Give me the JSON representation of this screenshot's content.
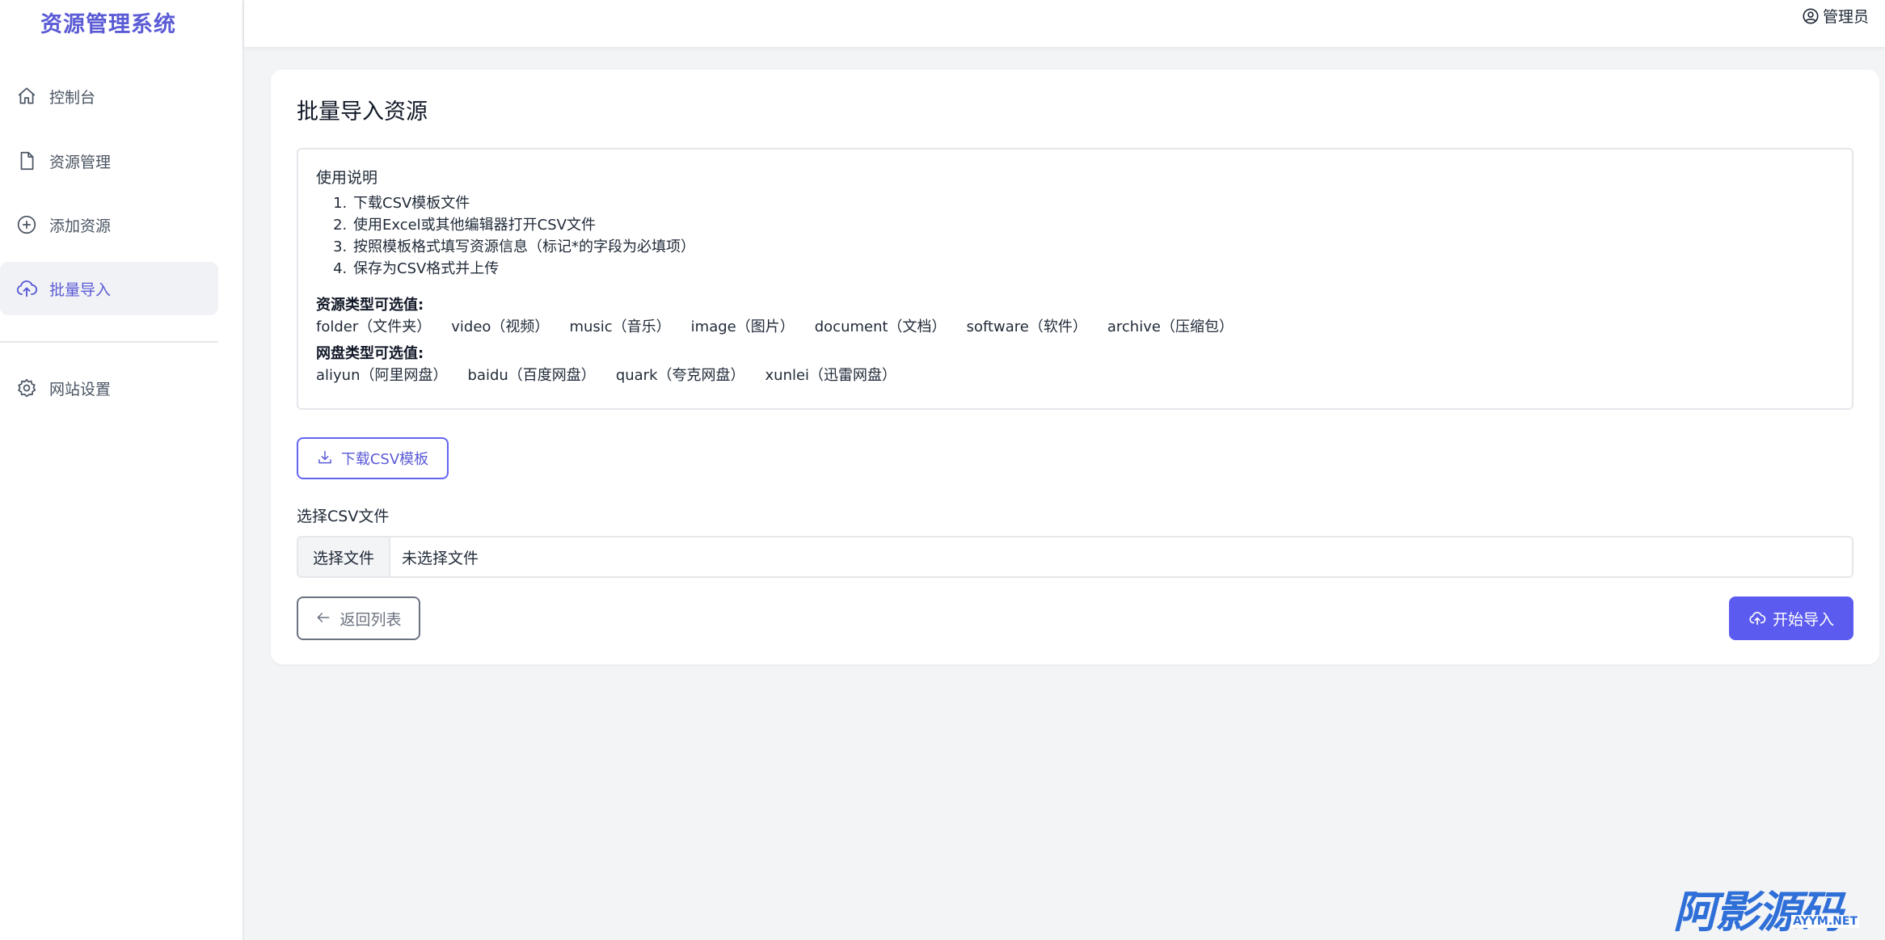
{
  "app": {
    "title": "资源管理系统"
  },
  "sidebar": {
    "items": [
      {
        "label": "控制台",
        "icon": "home-icon"
      },
      {
        "label": "资源管理",
        "icon": "file-icon"
      },
      {
        "label": "添加资源",
        "icon": "plus-circle-icon"
      },
      {
        "label": "批量导入",
        "icon": "cloud-upload-icon",
        "active": true
      },
      {
        "label": "网站设置",
        "icon": "gear-icon"
      }
    ]
  },
  "topbar": {
    "user": "管理员"
  },
  "page": {
    "title": "批量导入资源",
    "instructions": {
      "title": "使用说明",
      "steps": [
        "下载CSV模板文件",
        "使用Excel或其他编辑器打开CSV文件",
        "按照模板格式填写资源信息（标记*的字段为必填项）",
        "保存为CSV格式并上传"
      ],
      "type_title": "资源类型可选值:",
      "types": [
        "folder（文件夹）",
        "video（视频）",
        "music（音乐）",
        "image（图片）",
        "document（文档）",
        "software（软件）",
        "archive（压缩包）"
      ],
      "disk_title": "网盘类型可选值:",
      "disks": [
        "aliyun（阿里网盘）",
        "baidu（百度网盘）",
        "quark（夸克网盘）",
        "xunlei（迅雷网盘）"
      ]
    },
    "download_button": "下载CSV模板",
    "file_label": "选择CSV文件",
    "file_button": "选择文件",
    "file_status": "未选择文件",
    "back_button": "返回列表",
    "import_button": "开始导入"
  },
  "watermark": {
    "main": "阿影源码",
    "sub": "AYYM.NET"
  },
  "colors": {
    "accent": "#5b5bf0",
    "brand": "#5b5bd6",
    "sidebar_active_bg": "#f1f2f5",
    "page_bg": "#f3f4f6"
  }
}
